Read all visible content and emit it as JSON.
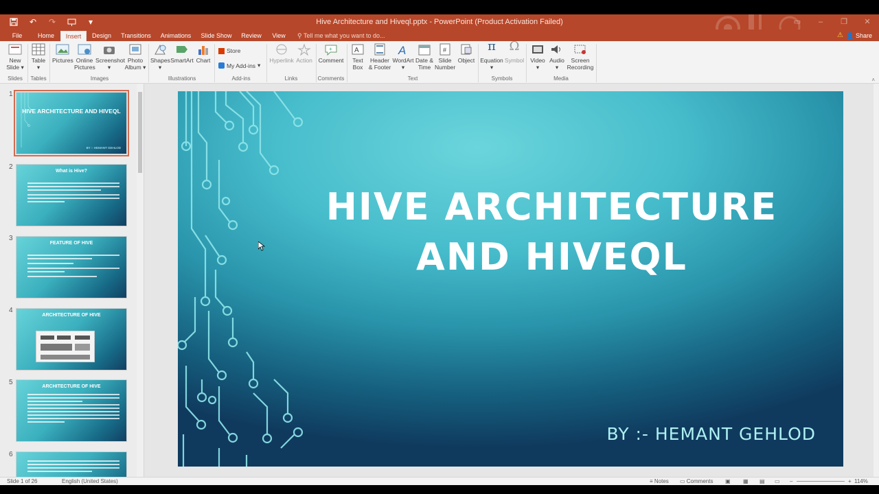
{
  "window": {
    "title": "Hive Architecture and Hiveql.pptx - PowerPoint (Product Activation Failed)",
    "share_label": "Share"
  },
  "tabs": [
    "File",
    "Home",
    "Insert",
    "Design",
    "Transitions",
    "Animations",
    "Slide Show",
    "Review",
    "View"
  ],
  "active_tab": "Insert",
  "tell_me": "Tell me what you want to do...",
  "ribbon": {
    "new_slide": "New Slide",
    "table": "Table",
    "pictures": "Pictures",
    "online_pictures": "Online Pictures",
    "screenshot": "Screenshot",
    "photo_album": "Photo Album",
    "shapes": "Shapes",
    "smartart": "SmartArt",
    "chart": "Chart",
    "store": "Store",
    "my_addins": "My Add-ins",
    "hyperlink": "Hyperlink",
    "action": "Action",
    "comment": "Comment",
    "text_box": "Text Box",
    "header_footer": "Header & Footer",
    "wordart": "WordArt",
    "date_time": "Date & Time",
    "slide_number": "Slide Number",
    "object": "Object",
    "equation": "Equation",
    "symbol": "Symbol",
    "video": "Video",
    "audio": "Audio",
    "screen_recording": "Screen Recording",
    "groups": {
      "slides": "Slides",
      "tables": "Tables",
      "images": "Images",
      "illustrations": "Illustrations",
      "addins": "Add-ins",
      "links": "Links",
      "comments": "Comments",
      "text": "Text",
      "symbols": "Symbols",
      "media": "Media"
    }
  },
  "thumbnails": [
    {
      "number": "1",
      "title": "HIVE ARCHITECTURE AND HIVEQL",
      "byline": "BY :- HEMANT GEHLOD"
    },
    {
      "number": "2",
      "title": "What is Hive?"
    },
    {
      "number": "3",
      "title": "FEATURE OF HIVE"
    },
    {
      "number": "4",
      "title": "ARCHITECTURE OF HIVE"
    },
    {
      "number": "5",
      "title": "ARCHITECTURE OF HIVE"
    },
    {
      "number": "6",
      "title": ""
    }
  ],
  "slide": {
    "title_line1": "HIVE ARCHITECTURE",
    "title_line2": "AND HIVEQL",
    "subtitle": "BY :- HEMANT GEHLOD"
  },
  "status": {
    "slide_counter": "Slide 1 of 26",
    "language": "English (United States)",
    "notes": "Notes",
    "comments": "Comments",
    "zoom": "114%"
  },
  "colors": {
    "accent": "#b7472a",
    "slide_teal": "#46bccb",
    "slide_navy": "#0f3a5e"
  }
}
